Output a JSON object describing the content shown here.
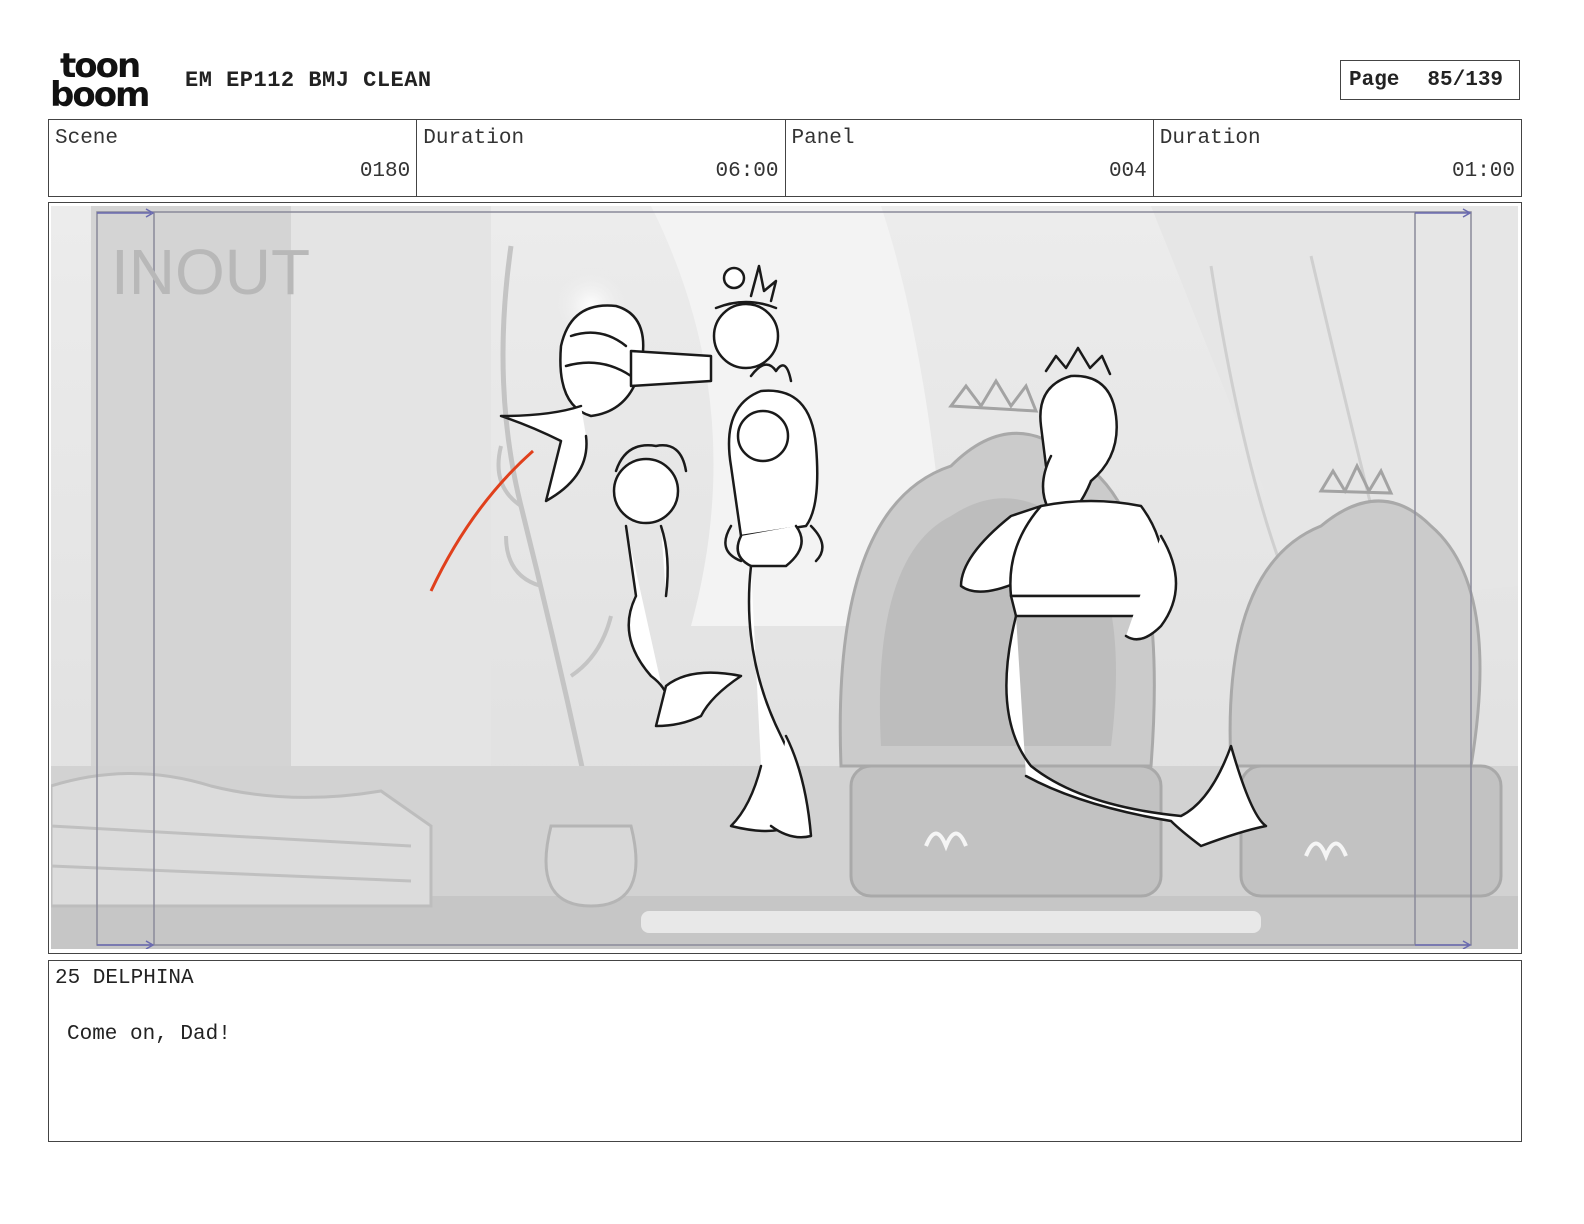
{
  "header": {
    "logo_top": "toon",
    "logo_bottom": "boom",
    "title": "EM EP112 BMJ CLEAN",
    "page_label": "Page",
    "page_value": "85/139"
  },
  "info": {
    "scene_label": "Scene",
    "scene_value": "0180",
    "scene_duration_label": "Duration",
    "scene_duration_value": "06:00",
    "panel_label": "Panel",
    "panel_value": "004",
    "panel_duration_label": "Duration",
    "panel_duration_value": "01:00"
  },
  "panel": {
    "overlay_text": "INOUT",
    "accent_color": "#e0401c"
  },
  "dialog": {
    "speaker": "25 DELPHINA",
    "line": "Come on, Dad!"
  }
}
